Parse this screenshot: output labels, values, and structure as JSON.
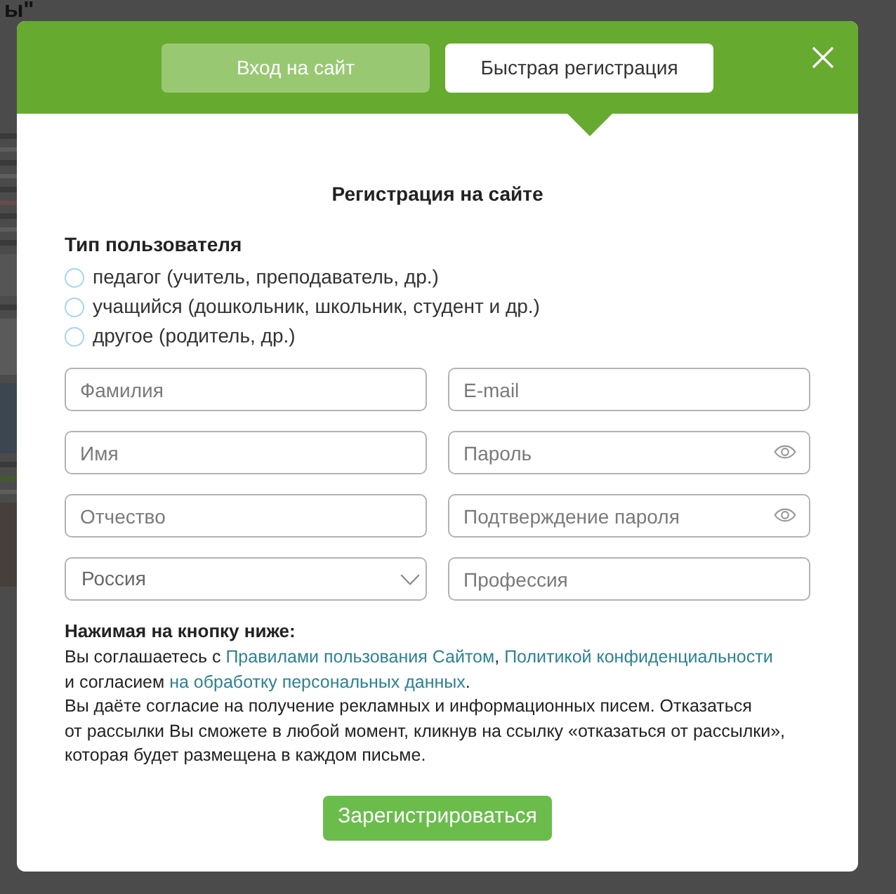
{
  "background_page": {
    "heading_fragment": "ы\""
  },
  "dialog": {
    "tabs": [
      {
        "label": "Вход на сайт",
        "selected": false
      },
      {
        "label": "Быстрая регистрация",
        "selected": true
      }
    ],
    "title": "Регистрация на сайте",
    "user_type": {
      "label": "Тип пользователя",
      "options": [
        {
          "label": "педагог (учитель, преподаватель, др.)",
          "selected": false
        },
        {
          "label": "учащийся (дошкольник, школьник, студент и др.)",
          "selected": false
        },
        {
          "label": "другое (родитель, др.)",
          "selected": false
        }
      ]
    },
    "fields": [
      {
        "kind": "text",
        "placeholder": "Фамилия"
      },
      {
        "kind": "text",
        "placeholder": "E-mail"
      },
      {
        "kind": "text",
        "placeholder": "Имя"
      },
      {
        "kind": "password",
        "placeholder": "Пароль"
      },
      {
        "kind": "text",
        "placeholder": "Отчество"
      },
      {
        "kind": "password",
        "placeholder": "Подтверждение пароля"
      },
      {
        "kind": "select",
        "value": "Россия"
      },
      {
        "kind": "text",
        "placeholder": "Профессия"
      }
    ],
    "consent": {
      "heading": "Нажимая на кнопку ниже:",
      "agreement_lines": [
        [
          {
            "kind": "text",
            "text": "Вы соглашаетесь с "
          },
          {
            "kind": "link",
            "text": "Правилами пользования Сайтом"
          },
          {
            "kind": "text",
            "text": ", "
          },
          {
            "kind": "link",
            "text": "Политикой конфиденциальности"
          }
        ],
        [
          {
            "kind": "text",
            "text": "и согласием "
          },
          {
            "kind": "link",
            "text": "на обработку персональных данных"
          },
          {
            "kind": "text",
            "text": "."
          }
        ]
      ],
      "mailing_lines": [
        "Вы даёте согласие на получение рекламных и информационных писем. Отказаться",
        "от рассылки Вы сможете в любой момент, кликнув на ссылку «отказаться от рассылки»,",
        "которая будет размещена в каждом письме."
      ]
    },
    "submit_button": "Зарегистрироваться"
  }
}
